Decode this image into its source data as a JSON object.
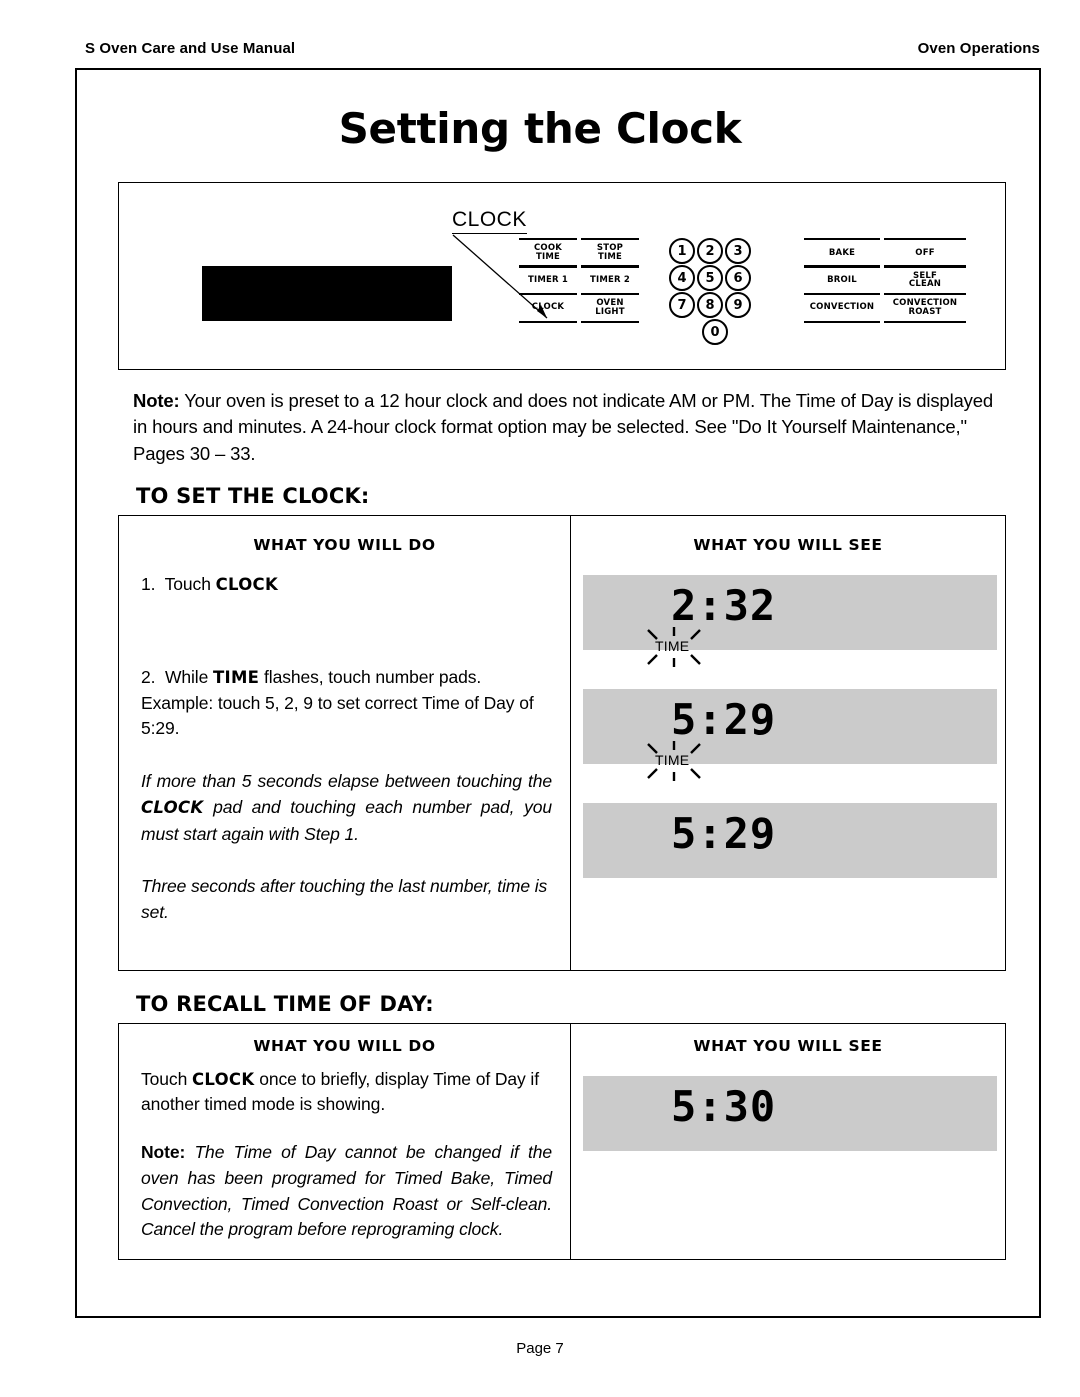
{
  "runhead": {
    "left": "S Oven Care and Use Manual",
    "right": "Oven Operations"
  },
  "title": "Setting the Clock",
  "control_panel": {
    "callout_label": "CLOCK",
    "function_pads": [
      "COOK TIME",
      "STOP TIME",
      "TIMER 1",
      "TIMER 2",
      "CLOCK",
      "OVEN LIGHT"
    ],
    "keypad": [
      "1",
      "2",
      "3",
      "4",
      "5",
      "6",
      "7",
      "8",
      "9",
      "0"
    ],
    "mode_pads": [
      "BAKE",
      "OFF",
      "BROIL",
      "SELF CLEAN",
      "CONVECTION",
      "CONVECTION ROAST"
    ]
  },
  "note": {
    "label": "Note:",
    "text": "Your oven is preset to a 12 hour clock and does not indicate AM or PM.  The Time of Day is displayed in hours and minutes.  A 24-hour clock format option may be selected.  See \"Do It Yourself Maintenance,\" Pages 30 – 33."
  },
  "set_clock": {
    "heading": "TO SET THE CLOCK:",
    "col_do": "WHAT  YOU  WILL DO",
    "col_see": "WHAT  YOU  WILL SEE",
    "step1_num": "1.",
    "step1_pre": "Touch ",
    "step1_bold": "CLOCK",
    "step2_num": "2.",
    "step2_pre": "While ",
    "step2_bold": "TIME",
    "step2_post": " flashes, touch number pads. Example: touch 5, 2, 9 to set correct Time of Day of 5:29.",
    "italic1_pre": "If more than 5 seconds elapse between touching the ",
    "italic1_bold": "CLOCK",
    "italic1_post": " pad and touching each number pad, you must start again with Step 1.",
    "italic2": "Three seconds after touching the last number, time is set.",
    "displays": [
      {
        "digits": "2:32",
        "indicator": "TIME",
        "flashing": true
      },
      {
        "digits": "5:29",
        "indicator": "TIME",
        "flashing": true
      },
      {
        "digits": "5:29",
        "indicator": "",
        "flashing": false
      }
    ]
  },
  "recall_time": {
    "heading": "TO RECALL TIME OF DAY:",
    "col_do": "WHAT  YOU  WILL DO",
    "col_see": "WHAT  YOU  WILL SEE",
    "body_pre": "Touch ",
    "body_bold": "CLOCK",
    "body_post": " once to briefly, display Time of Day if another timed mode is showing.",
    "note_label": "Note:",
    "note_text": "The Time of Day cannot be changed if the oven has been programed for Timed Bake, Timed Convection, Timed Convection Roast or Self-clean. Cancel the program before reprograming clock.",
    "displays": [
      {
        "digits": "5:30",
        "indicator": "",
        "flashing": false
      }
    ]
  },
  "footer": "Page 7"
}
